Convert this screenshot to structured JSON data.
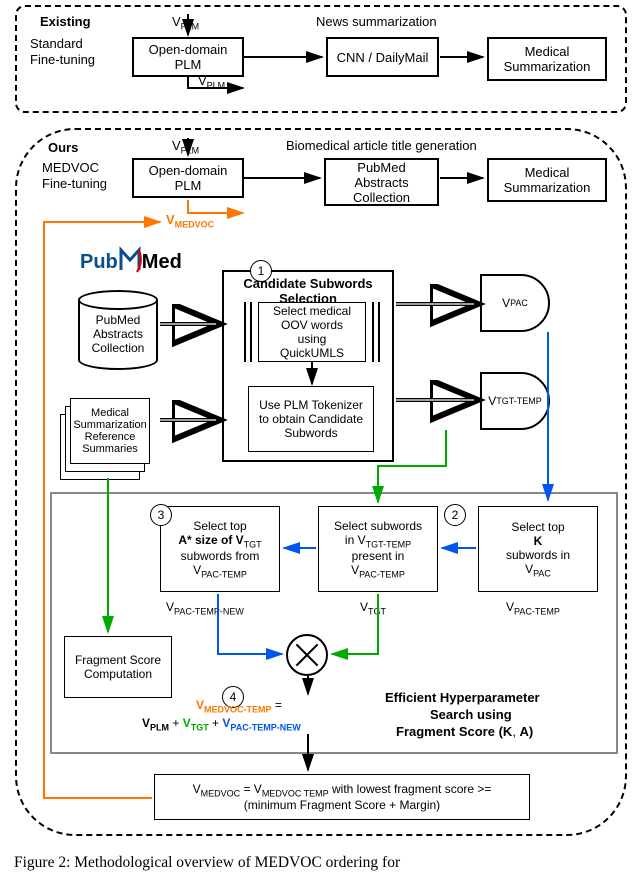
{
  "existing": {
    "title": "Existing",
    "subtitle": "Standard Fine-tuning",
    "vplm": "V",
    "vplm_sub": "PLM",
    "open_plm": "Open-domain PLM",
    "news_sum": "News summarization",
    "cnn": "CNN / DailyMail",
    "med_sum": "Medical Summarization"
  },
  "ours": {
    "title": "Ours",
    "subtitle": "MEDVOC Fine-tuning",
    "vplm": "V",
    "vplm_sub": "PLM",
    "open_plm": "Open-domain PLM",
    "bio_title": "Biomedical article title generation",
    "pac_box": "PubMed Abstracts Collection",
    "med_sum": "Medical Summarization",
    "vmedvoc": "V",
    "vmedvoc_sub": "MEDVOC"
  },
  "pubmed_logo": {
    "pub": "Pub",
    "med": "Med"
  },
  "db": "PubMed Abstracts Collection",
  "pages": "Medical Summarization Reference Summaries",
  "cand_sel": {
    "title": "Candidate Subwords Selection",
    "inner1": "Select medical OOV words using QuickUMLS",
    "inner2": "Use PLM Tokenizer to obtain Candidate Subwords"
  },
  "vpac": "V",
  "vpac_sub": "PAC",
  "vtgt_temp": "V",
  "vtgt_temp_sub": "TGT-TEMP",
  "hps": {
    "title1": "Efficient Hyperparameter",
    "title2": "Search using",
    "title3": "Fragment Score (K, A)",
    "box_c": "Select top A* size of Vₑ subwords from Vₑ",
    "box_b": "Select subwords in Vₑ present in Vₑ",
    "box_a": "Select top K subwords in Vₑ",
    "box_c_text_1": "Select top",
    "box_c_text_2": "A* size of V",
    "box_c_text_2_sub": "TGT",
    "box_c_text_3": "subwords from",
    "box_c_text_4": "V",
    "box_c_text_4_sub": "PAC-TEMP",
    "box_b_text_1": "Select subwords",
    "box_b_text_2": "in V",
    "box_b_text_2_sub": "TGT-TEMP",
    "box_b_text_3": "present in",
    "box_b_text_4": "V",
    "box_b_text_4_sub": "PAC-TEMP",
    "box_a_text_1": "Select top",
    "box_a_text_2": "K",
    "box_a_text_3": "subwords in",
    "box_a_text_4": "V",
    "box_a_text_4_sub": "PAC",
    "lab_c": "V",
    "lab_c_sub": "PAC-TEMP-NEW",
    "lab_b": "V",
    "lab_b_sub": "TGT",
    "lab_a": "V",
    "lab_a_sub": "PAC-TEMP",
    "frag_box": "Fragment Score Computation",
    "vmedvoc_temp": "V",
    "vmedvoc_temp_sub": "MEDVOC-TEMP",
    "eq_eq": " = ",
    "eq_plm": "V",
    "eq_plm_sub": "PLM",
    "eq_plus": " + ",
    "eq_tgt": "V",
    "eq_tgt_sub": "TGT",
    "eq_pacnew": "V",
    "eq_pacnew_sub": "PAC-TEMP-NEW"
  },
  "final_box_1": "V",
  "final_box_1_sub": "MEDVOC",
  "final_box_2": " = V",
  "final_box_2_sub": "MEDVOC TEMP",
  "final_box_3": " with lowest fragment score >=",
  "final_box_4": "(minimum Fragment Score + Margin)",
  "steps": {
    "s1": "1",
    "s2": "2",
    "s3": "3",
    "s4": "4"
  },
  "caption": "Figure 2: Methodological overview of MEDVOC ordering for"
}
